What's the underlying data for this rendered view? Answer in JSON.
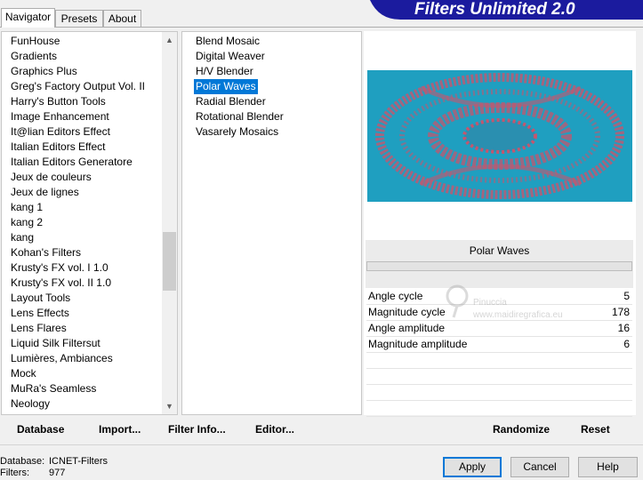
{
  "tabs": [
    "Navigator",
    "Presets",
    "About"
  ],
  "app_title": "Filters Unlimited 2.0",
  "categories": [
    "FunHouse",
    "Gradients",
    "Graphics Plus",
    "Greg's Factory Output Vol. II",
    "Harry's Button Tools",
    "Image Enhancement",
    "It@lian Editors Effect",
    "Italian Editors Effect",
    "Italian Editors Generatore",
    "Jeux de couleurs",
    "Jeux de lignes",
    "kang 1",
    "kang 2",
    "kang",
    "Kohan's Filters",
    "Krusty's FX vol. I 1.0",
    "Krusty's FX vol. II 1.0",
    "Layout Tools",
    "Lens Effects",
    "Lens Flares",
    "Liquid Silk Filtersut",
    "Lumières, Ambiances",
    "Mock",
    "MuRa's Seamless",
    "Neology"
  ],
  "filters": {
    "items": [
      "Blend Mosaic",
      "Digital Weaver",
      "H/V Blender",
      "Polar Waves",
      "Radial Blender",
      "Rotational Blender",
      "Vasarely Mosaics"
    ],
    "selected": "Polar Waves"
  },
  "preview": {
    "filter_name": "Polar Waves",
    "colors": {
      "cyan": "#1f9fc0",
      "pink": "#c4566e"
    }
  },
  "parameters": [
    {
      "name": "Angle cycle",
      "value": "5"
    },
    {
      "name": "Magnitude cycle",
      "value": "178"
    },
    {
      "name": "Angle amplitude",
      "value": "16"
    },
    {
      "name": "Magnitude amplitude",
      "value": "6"
    }
  ],
  "toolbar": {
    "database": "Database",
    "import": "Import...",
    "filter_info": "Filter Info...",
    "editor": "Editor...",
    "randomize": "Randomize",
    "reset": "Reset"
  },
  "status": {
    "database_label": "Database:",
    "database_value": "ICNET-Filters",
    "filters_label": "Filters:",
    "filters_value": "977"
  },
  "buttons": {
    "apply": "Apply",
    "cancel": "Cancel",
    "help": "Help"
  },
  "watermark": {
    "line1": "Pinuccia",
    "line2": "www.maidiregrafica.eu"
  }
}
